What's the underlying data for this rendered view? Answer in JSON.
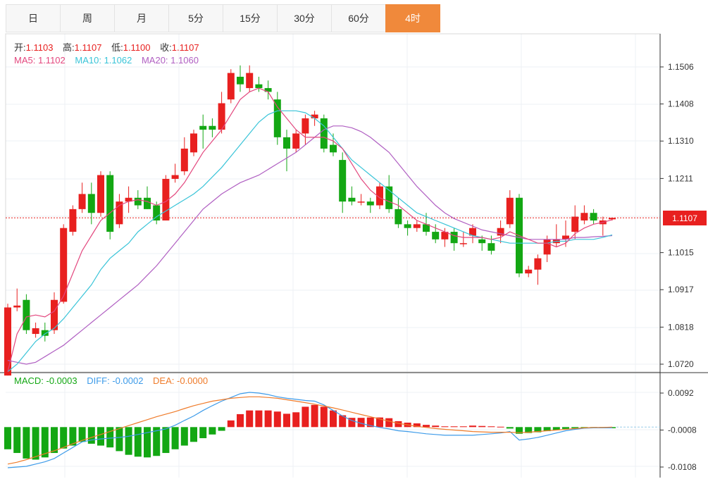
{
  "tabs": [
    {
      "label": "日"
    },
    {
      "label": "周"
    },
    {
      "label": "月"
    },
    {
      "label": "5分"
    },
    {
      "label": "15分"
    },
    {
      "label": "30分"
    },
    {
      "label": "60分"
    },
    {
      "label": "4时",
      "active": true
    }
  ],
  "ohlc": {
    "open_label": "开:",
    "open": "1.1103",
    "high_label": "高:",
    "high": "1.1107",
    "low_label": "低:",
    "low": "1.1100",
    "close_label": "收:",
    "close": "1.1107"
  },
  "ma": {
    "ma5_label": "MA5: ",
    "ma5": "1.1102",
    "ma10_label": "MA10: ",
    "ma10": "1.1062",
    "ma20_label": "MA20: ",
    "ma20": "1.1060"
  },
  "macd": {
    "macd_label": "MACD: ",
    "macd": "-0.0003",
    "diff_label": "DIFF: ",
    "diff": "-0.0002",
    "dea_label": "DEA: ",
    "dea": "-0.0000"
  },
  "current_price": "1.1107",
  "colors": {
    "up": "#e8201f",
    "down": "#13a713",
    "ma5": "#e3477e",
    "ma10": "#39c4d8",
    "ma20": "#b05fc2",
    "diff": "#3d9be9",
    "dea": "#ef7b2a",
    "grid": "#eef1f4",
    "axis": "#333333"
  },
  "chart_data": {
    "type": "candlestick",
    "price_ticks": [
      "1.1506",
      "1.1408",
      "1.1310",
      "1.1211",
      "1.1015",
      "1.0917",
      "1.0818",
      "1.0720"
    ],
    "macd_ticks": [
      "0.0092",
      "-0.0008",
      "-0.0108"
    ],
    "candles": [
      [
        1.069,
        1.088,
        1.069,
        1.087
      ],
      [
        1.087,
        1.092,
        1.086,
        1.0875
      ],
      [
        1.089,
        1.0905,
        1.08,
        1.081
      ],
      [
        1.08,
        1.083,
        1.079,
        1.0815
      ],
      [
        1.081,
        1.083,
        1.078,
        1.0795
      ],
      [
        1.081,
        1.091,
        1.08,
        1.089
      ],
      [
        1.0885,
        1.109,
        1.088,
        1.108
      ],
      [
        1.107,
        1.114,
        1.106,
        1.113
      ],
      [
        1.113,
        1.12,
        1.112,
        1.117
      ],
      [
        1.117,
        1.12,
        1.109,
        1.112
      ],
      [
        1.112,
        1.123,
        1.111,
        1.122
      ],
      [
        1.122,
        1.123,
        1.105,
        1.107
      ],
      [
        1.109,
        1.117,
        1.108,
        1.115
      ],
      [
        1.115,
        1.119,
        1.112,
        1.116
      ],
      [
        1.116,
        1.118,
        1.113,
        1.114
      ],
      [
        1.116,
        1.119,
        1.113,
        1.113
      ],
      [
        1.114,
        1.115,
        1.109,
        1.11
      ],
      [
        1.11,
        1.122,
        1.11,
        1.121
      ],
      [
        1.121,
        1.125,
        1.12,
        1.122
      ],
      [
        1.123,
        1.132,
        1.122,
        1.129
      ],
      [
        1.128,
        1.134,
        1.127,
        1.133
      ],
      [
        1.135,
        1.138,
        1.129,
        1.134
      ],
      [
        1.135,
        1.137,
        1.132,
        1.134
      ],
      [
        1.134,
        1.144,
        1.133,
        1.141
      ],
      [
        1.142,
        1.15,
        1.141,
        1.149
      ],
      [
        1.148,
        1.151,
        1.144,
        1.146
      ],
      [
        1.145,
        1.151,
        1.144,
        1.149
      ],
      [
        1.146,
        1.148,
        1.144,
        1.145
      ],
      [
        1.145,
        1.147,
        1.142,
        1.144
      ],
      [
        1.142,
        1.144,
        1.13,
        1.132
      ],
      [
        1.132,
        1.134,
        1.123,
        1.129
      ],
      [
        1.129,
        1.134,
        1.128,
        1.133
      ],
      [
        1.133,
        1.138,
        1.13,
        1.137
      ],
      [
        1.137,
        1.139,
        1.135,
        1.138
      ],
      [
        1.137,
        1.138,
        1.128,
        1.129
      ],
      [
        1.13,
        1.133,
        1.127,
        1.128
      ],
      [
        1.126,
        1.128,
        1.112,
        1.115
      ],
      [
        1.116,
        1.119,
        1.114,
        1.115
      ],
      [
        1.115,
        1.117,
        1.114,
        1.115
      ],
      [
        1.115,
        1.116,
        1.112,
        1.114
      ],
      [
        1.114,
        1.12,
        1.113,
        1.119
      ],
      [
        1.119,
        1.122,
        1.112,
        1.113
      ],
      [
        1.113,
        1.116,
        1.108,
        1.109
      ],
      [
        1.109,
        1.11,
        1.106,
        1.108
      ],
      [
        1.108,
        1.11,
        1.107,
        1.109
      ],
      [
        1.109,
        1.112,
        1.106,
        1.107
      ],
      [
        1.107,
        1.109,
        1.104,
        1.105
      ],
      [
        1.105,
        1.108,
        1.103,
        1.107
      ],
      [
        1.107,
        1.108,
        1.102,
        1.104
      ],
      [
        1.104,
        1.107,
        1.103,
        1.104
      ],
      [
        1.106,
        1.109,
        1.104,
        1.108
      ],
      [
        1.105,
        1.106,
        1.102,
        1.104
      ],
      [
        1.104,
        1.106,
        1.101,
        1.102
      ],
      [
        1.106,
        1.11,
        1.104,
        1.108
      ],
      [
        1.109,
        1.118,
        1.108,
        1.116
      ],
      [
        1.116,
        1.117,
        1.095,
        1.096
      ],
      [
        1.096,
        1.098,
        1.095,
        1.097
      ],
      [
        1.097,
        1.101,
        1.093,
        1.1
      ],
      [
        1.101,
        1.106,
        1.099,
        1.105
      ],
      [
        1.104,
        1.109,
        1.103,
        1.105
      ],
      [
        1.105,
        1.11,
        1.103,
        1.106
      ],
      [
        1.107,
        1.114,
        1.105,
        1.111
      ],
      [
        1.11,
        1.114,
        1.109,
        1.112
      ],
      [
        1.112,
        1.113,
        1.109,
        1.11
      ],
      [
        1.109,
        1.111,
        1.106,
        1.11
      ],
      [
        1.1103,
        1.1107,
        1.11,
        1.1107
      ]
    ],
    "ma5": [
      1.07,
      1.08,
      1.0845,
      1.085,
      1.0845,
      1.086,
      1.09,
      1.096,
      1.102,
      1.106,
      1.11,
      1.112,
      1.114,
      1.115,
      1.1155,
      1.115,
      1.114,
      1.115,
      1.117,
      1.12,
      1.124,
      1.128,
      1.131,
      1.134,
      1.138,
      1.142,
      1.144,
      1.145,
      1.144,
      1.14,
      1.137,
      1.134,
      1.132,
      1.132,
      1.132,
      1.131,
      1.129,
      1.125,
      1.121,
      1.118,
      1.116,
      1.115,
      1.114,
      1.112,
      1.11,
      1.109,
      1.108,
      1.107,
      1.106,
      1.1055,
      1.1055,
      1.1055,
      1.105,
      1.1055,
      1.107,
      1.106,
      1.105,
      1.104,
      1.104,
      1.103,
      1.104,
      1.1065,
      1.108,
      1.109,
      1.1095,
      1.1102
    ],
    "ma10": [
      1.07,
      1.072,
      1.075,
      1.078,
      1.08,
      1.0815,
      1.084,
      1.087,
      1.09,
      1.093,
      1.097,
      1.1,
      1.102,
      1.104,
      1.107,
      1.109,
      1.111,
      1.1125,
      1.114,
      1.1155,
      1.117,
      1.119,
      1.1215,
      1.124,
      1.127,
      1.13,
      1.133,
      1.136,
      1.138,
      1.139,
      1.139,
      1.139,
      1.1385,
      1.137,
      1.135,
      1.132,
      1.129,
      1.126,
      1.124,
      1.122,
      1.12,
      1.118,
      1.116,
      1.114,
      1.112,
      1.111,
      1.11,
      1.109,
      1.108,
      1.107,
      1.106,
      1.1055,
      1.105,
      1.1045,
      1.104,
      1.104,
      1.104,
      1.104,
      1.104,
      1.1045,
      1.1045,
      1.105,
      1.105,
      1.105,
      1.1055,
      1.1062
    ],
    "ma20": [
      1.073,
      1.0725,
      1.072,
      1.0725,
      1.074,
      1.0755,
      1.077,
      1.079,
      1.081,
      1.083,
      1.085,
      1.087,
      1.089,
      1.091,
      1.093,
      1.0955,
      1.098,
      1.101,
      1.104,
      1.107,
      1.11,
      1.113,
      1.115,
      1.117,
      1.1185,
      1.12,
      1.121,
      1.122,
      1.1235,
      1.125,
      1.1265,
      1.128,
      1.13,
      1.132,
      1.134,
      1.135,
      1.135,
      1.1345,
      1.1335,
      1.132,
      1.13,
      1.128,
      1.125,
      1.122,
      1.119,
      1.1165,
      1.114,
      1.112,
      1.1105,
      1.1095,
      1.1085,
      1.1075,
      1.107,
      1.1065,
      1.106,
      1.1055,
      1.105,
      1.105,
      1.105,
      1.105,
      1.105,
      1.1055,
      1.1055,
      1.1057,
      1.1058,
      1.106
    ],
    "macd_hist": [
      -0.006,
      -0.007,
      -0.0085,
      -0.0088,
      -0.0082,
      -0.007,
      -0.0058,
      -0.005,
      -0.004,
      -0.0045,
      -0.005,
      -0.0055,
      -0.0065,
      -0.0075,
      -0.008,
      -0.0082,
      -0.0078,
      -0.007,
      -0.006,
      -0.005,
      -0.004,
      -0.003,
      -0.002,
      -0.001,
      0.0018,
      0.0035,
      0.0045,
      0.0045,
      0.0045,
      0.0042,
      0.0036,
      0.004,
      0.0055,
      0.006,
      0.0055,
      0.0045,
      0.0032,
      0.0025,
      0.0025,
      0.0026,
      0.0026,
      0.0024,
      0.0016,
      0.0012,
      0.001,
      0.0006,
      0.0004,
      0.0002,
      0.0002,
      0.0002,
      0.0004,
      0.0003,
      0.0002,
      0.0001,
      -0.0004,
      -0.0018,
      -0.0016,
      -0.0014,
      -0.0011,
      -0.0008,
      -0.0005,
      -0.0003,
      -0.0002,
      -0.0001,
      -0.0001,
      -0.0003
    ],
    "diff": [
      -0.011,
      -0.0108,
      -0.0106,
      -0.01,
      -0.0094,
      -0.0085,
      -0.007,
      -0.0055,
      -0.004,
      -0.0035,
      -0.0032,
      -0.003,
      -0.0028,
      -0.0025,
      -0.002,
      -0.0015,
      -0.001,
      -0.0005,
      0.0005,
      0.0018,
      0.003,
      0.0045,
      0.0058,
      0.007,
      0.008,
      0.009,
      0.0094,
      0.0092,
      0.0088,
      0.0082,
      0.0078,
      0.0075,
      0.0072,
      0.007,
      0.006,
      0.0045,
      0.003,
      0.0018,
      0.001,
      0.0004,
      -0.0001,
      -0.0005,
      -0.001,
      -0.0012,
      -0.0015,
      -0.0018,
      -0.002,
      -0.0022,
      -0.0022,
      -0.0022,
      -0.0022,
      -0.002,
      -0.0018,
      -0.0016,
      -0.0012,
      -0.0035,
      -0.0032,
      -0.0028,
      -0.0022,
      -0.0016,
      -0.001,
      -0.0006,
      -0.0003,
      -0.0002,
      -0.0002,
      -0.0002
    ],
    "dea": [
      -0.01,
      -0.0095,
      -0.0088,
      -0.008,
      -0.0072,
      -0.0064,
      -0.0055,
      -0.0045,
      -0.0036,
      -0.0028,
      -0.002,
      -0.0012,
      -0.0004,
      0.0004,
      0.0012,
      0.002,
      0.0028,
      0.0035,
      0.0042,
      0.005,
      0.0058,
      0.0064,
      0.007,
      0.0074,
      0.0078,
      0.008,
      0.0082,
      0.0082,
      0.008,
      0.0078,
      0.0074,
      0.007,
      0.0066,
      0.0062,
      0.0057,
      0.0052,
      0.0046,
      0.004,
      0.0034,
      0.0028,
      0.0022,
      0.0016,
      0.001,
      0.0006,
      0.0002,
      -0.0001,
      -0.0004,
      -0.0006,
      -0.0008,
      -0.001,
      -0.0012,
      -0.0013,
      -0.0014,
      -0.0014,
      -0.0014,
      -0.0015,
      -0.0014,
      -0.0012,
      -0.001,
      -0.0008,
      -0.0006,
      -0.0004,
      -0.0002,
      -0.0001,
      -0.0001,
      0.0
    ]
  }
}
